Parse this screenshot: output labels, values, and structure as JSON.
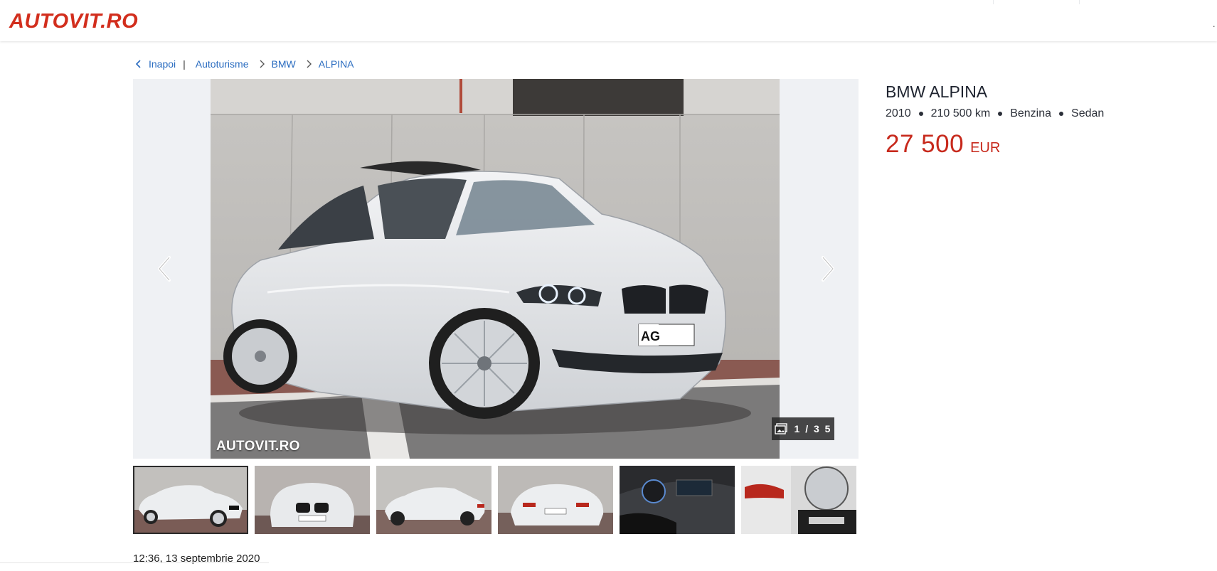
{
  "header": {
    "logo_text": "AUTOVIT.RO"
  },
  "breadcrumb": {
    "back_label": "Inapoi",
    "separator": "|",
    "items": [
      {
        "label": "Autoturisme"
      },
      {
        "label": "BMW"
      },
      {
        "label": "ALPINA"
      }
    ]
  },
  "gallery": {
    "watermark": "AUTOVIT.RO",
    "counter": "1 / 3 5",
    "thumbnail_count_visible": 6,
    "prev_icon": "chevron-left-icon",
    "next_icon": "chevron-right-icon"
  },
  "listing": {
    "title": "BMW ALPINA",
    "year": "2010",
    "mileage": "210 500 km",
    "fuel": "Benzina",
    "body": "Sedan",
    "price_amount": "27 500",
    "price_currency": "EUR",
    "posted": "12:36, 13 septembrie 2020"
  },
  "colors": {
    "brand_red": "#d22e1d",
    "price_red": "#c7291c",
    "link_blue": "#2a6cc0"
  }
}
